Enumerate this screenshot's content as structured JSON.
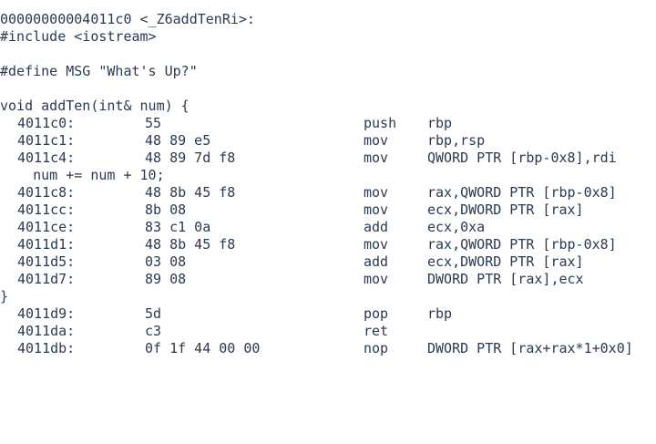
{
  "lines": [
    {
      "type": "src",
      "text": "00000000004011c0 <_Z6addTenRi>:"
    },
    {
      "type": "src",
      "text": "#include <iostream>"
    },
    {
      "type": "src",
      "text": ""
    },
    {
      "type": "src",
      "text": "#define MSG \"What's Up?\""
    },
    {
      "type": "src",
      "text": ""
    },
    {
      "type": "src",
      "text": "void addTen(int& num) {"
    },
    {
      "type": "asm",
      "addr": "4011c0:",
      "bytes": "55",
      "mnem": "push",
      "ops": "rbp"
    },
    {
      "type": "asm",
      "addr": "4011c1:",
      "bytes": "48 89 e5",
      "mnem": "mov",
      "ops": "rbp,rsp"
    },
    {
      "type": "asm",
      "addr": "4011c4:",
      "bytes": "48 89 7d f8",
      "mnem": "mov",
      "ops": "QWORD PTR [rbp-0x8],rdi"
    },
    {
      "type": "src",
      "text": "    num += num + 10;"
    },
    {
      "type": "asm",
      "addr": "4011c8:",
      "bytes": "48 8b 45 f8",
      "mnem": "mov",
      "ops": "rax,QWORD PTR [rbp-0x8]"
    },
    {
      "type": "asm",
      "addr": "4011cc:",
      "bytes": "8b 08",
      "mnem": "mov",
      "ops": "ecx,DWORD PTR [rax]"
    },
    {
      "type": "asm",
      "addr": "4011ce:",
      "bytes": "83 c1 0a",
      "mnem": "add",
      "ops": "ecx,0xa"
    },
    {
      "type": "asm",
      "addr": "4011d1:",
      "bytes": "48 8b 45 f8",
      "mnem": "mov",
      "ops": "rax,QWORD PTR [rbp-0x8]"
    },
    {
      "type": "asm",
      "addr": "4011d5:",
      "bytes": "03 08",
      "mnem": "add",
      "ops": "ecx,DWORD PTR [rax]"
    },
    {
      "type": "asm",
      "addr": "4011d7:",
      "bytes": "89 08",
      "mnem": "mov",
      "ops": "DWORD PTR [rax],ecx"
    },
    {
      "type": "src",
      "text": "}"
    },
    {
      "type": "asm",
      "addr": "4011d9:",
      "bytes": "5d",
      "mnem": "pop",
      "ops": "rbp"
    },
    {
      "type": "asm",
      "addr": "4011da:",
      "bytes": "c3",
      "mnem": "ret",
      "ops": ""
    },
    {
      "type": "asm",
      "addr": "4011db:",
      "bytes": "0f 1f 44 00 00",
      "mnem": "nop",
      "ops": "DWORD PTR [rax+rax*1+0x0]"
    }
  ]
}
